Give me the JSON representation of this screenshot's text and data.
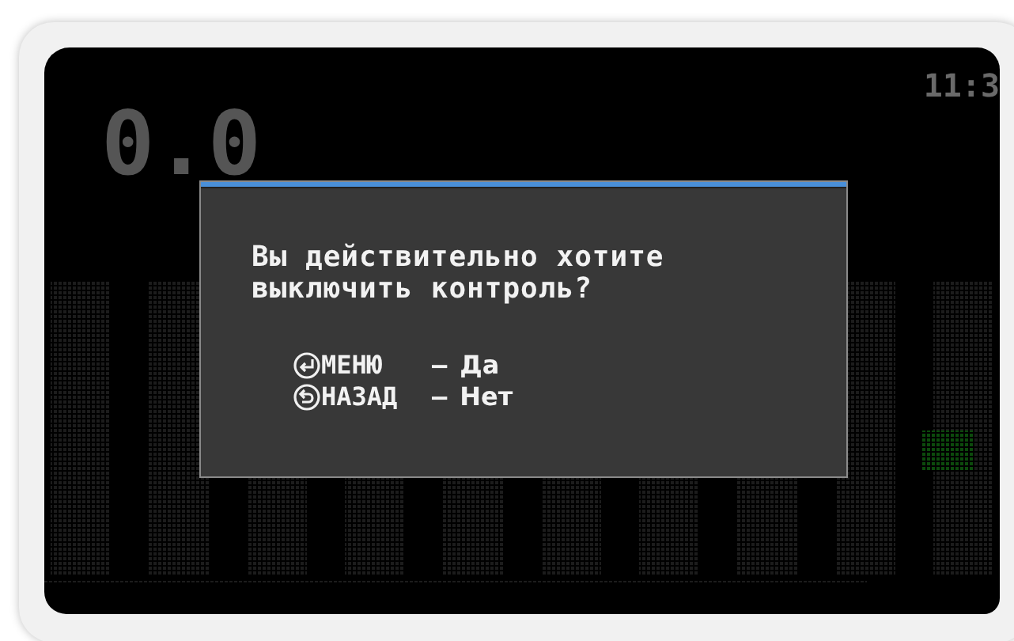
{
  "screen": {
    "speed": "0.0",
    "clock": "11:3"
  },
  "dialog": {
    "message_lines": [
      "Вы действительно хотите",
      "выключить контроль?"
    ],
    "options": [
      {
        "kind": "enter",
        "key": "МЕНЮ",
        "dash": "–",
        "answer": "Да"
      },
      {
        "kind": "back",
        "key": "НАЗАД",
        "dash": "–",
        "answer": "Нет"
      }
    ]
  }
}
